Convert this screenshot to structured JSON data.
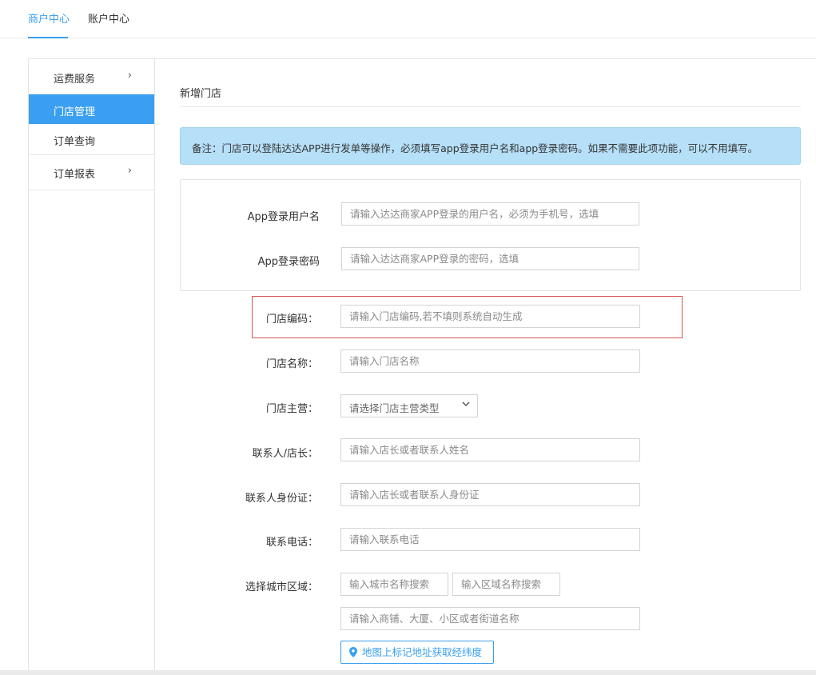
{
  "topnav": {
    "tabs": [
      {
        "label": "商户中心",
        "active": true
      },
      {
        "label": "账户中心",
        "active": false
      }
    ]
  },
  "sidebar": {
    "items": [
      {
        "label": "运费服务",
        "has_chevron": true,
        "chevron": "›"
      },
      {
        "label": "门店管理",
        "active": true
      },
      {
        "label": "订单查询"
      },
      {
        "label": "订单报表",
        "has_chevron": true,
        "chevron": "›"
      }
    ]
  },
  "page": {
    "title": "新增门店",
    "notice": "备注：门店可以登陆达达APP进行发单等操作，必须填写app登录用户名和app登录密码。如果不需要此项功能，可以不用填写。"
  },
  "form": {
    "app_username": {
      "label": "App登录用户名",
      "placeholder": "请输入达达商家APP登录的用户名，必须为手机号，选填"
    },
    "app_password": {
      "label": "App登录密码",
      "placeholder": "请输入达达商家APP登录的密码，选填"
    },
    "store_code": {
      "label": "门店编码：",
      "placeholder": "请输入门店编码,若不填则系统自动生成"
    },
    "store_name": {
      "label": "门店名称：",
      "placeholder": "请输入门店名称"
    },
    "store_category": {
      "label": "门店主营：",
      "selected": "请选择门店主营类型"
    },
    "contact_name": {
      "label": "联系人/店长：",
      "placeholder": "请输入店长或者联系人姓名"
    },
    "contact_id": {
      "label": "联系人身份证：",
      "placeholder": "请输入店长或者联系人身份证"
    },
    "contact_phone": {
      "label": "联系电话：",
      "placeholder": "请输入联系电话"
    },
    "city_area": {
      "label": "选择城市区域：",
      "city_placeholder": "输入城市名称搜索",
      "area_placeholder": "输入区域名称搜索",
      "address_placeholder": "请输入商铺、大厦、小区或者街道名称",
      "map_button": "地图上标记地址获取经纬度"
    }
  },
  "colors": {
    "accent": "#3a9ff0",
    "notice_bg": "#b6dff8",
    "highlight_border": "#d9534f"
  },
  "icons": {
    "chevron": "chevron-right-icon",
    "select_caret": "chevron-down-icon",
    "map_pin": "map-pin-icon"
  }
}
